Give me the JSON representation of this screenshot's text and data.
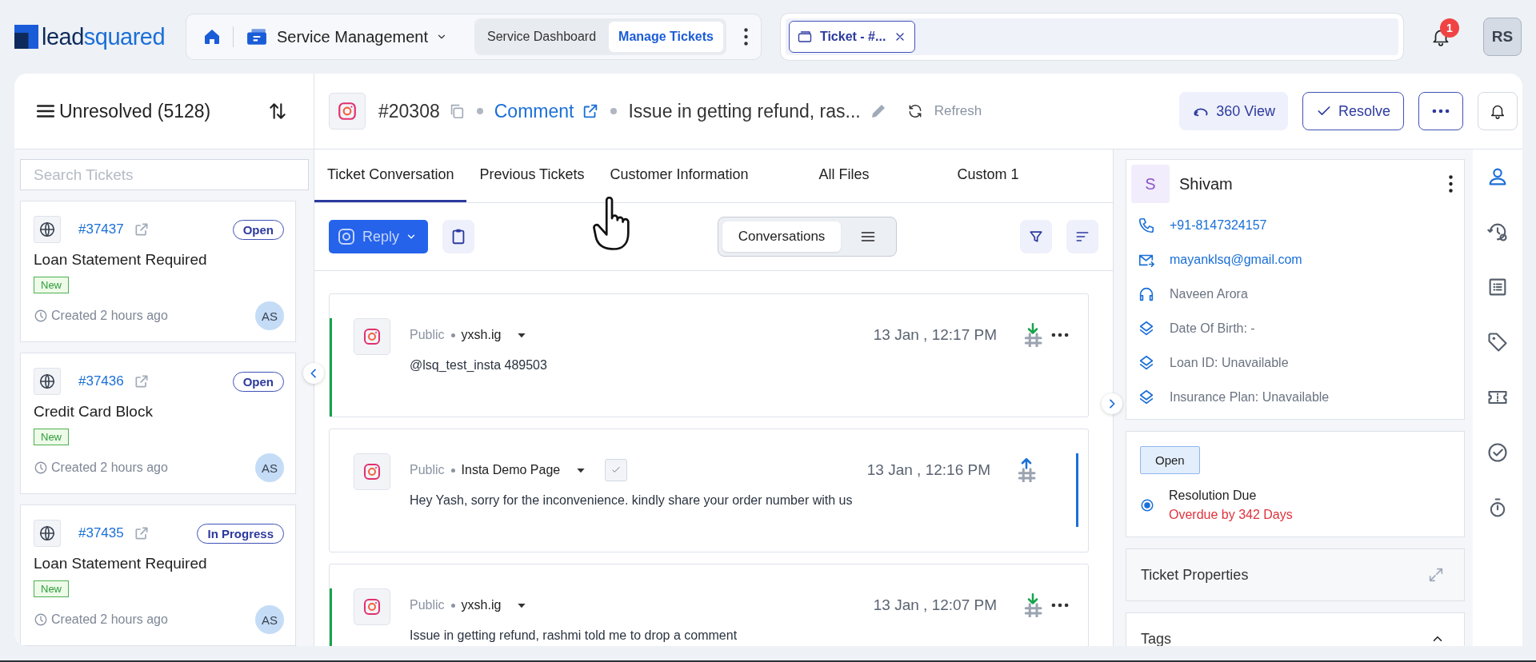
{
  "header": {
    "logo": {
      "dark_part": "lead",
      "accent_part": "squared"
    },
    "app_name": "Service Management",
    "nav_tabs": [
      {
        "label": "Service Dashboard",
        "selected": false
      },
      {
        "label": "Manage Tickets",
        "selected": true
      }
    ],
    "open_tabs": [
      {
        "label": "Ticket - #..."
      }
    ],
    "notification_count": "1",
    "user_initials": "RS"
  },
  "ticket_list": {
    "title": "Unresolved (5128)",
    "search": {
      "placeholder": "Search Tickets"
    },
    "tickets": [
      {
        "number": "#37437",
        "status": "Open",
        "subject": "Loan Statement Required",
        "tag": "New",
        "created": "Created 2 hours ago",
        "assignee": "AS"
      },
      {
        "number": "#37436",
        "status": "Open",
        "subject": "Credit Card Block",
        "tag": "New",
        "created": "Created 2 hours ago",
        "assignee": "AS"
      },
      {
        "number": "#37435",
        "status": "In Progress",
        "subject": "Loan Statement Required",
        "tag": "New",
        "created": "Created 2 hours ago",
        "assignee": "AS"
      }
    ]
  },
  "ticket": {
    "number": "#20308",
    "channel": "Comment",
    "subject": "Issue in getting refund, ras...",
    "refresh": "Refresh",
    "view_button": "360 View",
    "resolve_button": "Resolve"
  },
  "tabs": [
    {
      "label": "Ticket Conversation",
      "selected": true
    },
    {
      "label": "Previous Tickets",
      "selected": false
    },
    {
      "label": "Customer Information",
      "selected": false
    },
    {
      "label": "All Files",
      "selected": false
    },
    {
      "label": "Custom 1",
      "selected": false
    }
  ],
  "toolbar": {
    "reply": "Reply",
    "view_modes": [
      {
        "kind": "text",
        "label": "Conversations",
        "selected": true
      },
      {
        "kind": "list",
        "selected": false
      }
    ]
  },
  "messages": [
    {
      "kind": "incoming",
      "visibility": "Public",
      "author": "yxsh.ig",
      "time": "13 Jan , 12:17 PM",
      "text": "@lsq_test_insta 489503"
    },
    {
      "kind": "outgoing",
      "visibility": "Public",
      "author": "Insta Demo Page",
      "time": "13 Jan , 12:16 PM",
      "text": "Hey Yash, sorry for the inconvenience. kindly share your order number with us",
      "checked": true
    },
    {
      "kind": "incoming",
      "visibility": "Public",
      "author": "yxsh.ig",
      "time": "13 Jan , 12:07 PM",
      "text": "Issue in getting refund, rashmi told me to drop a comment"
    }
  ],
  "contact": {
    "initial": "S",
    "name": "Shivam",
    "fields": [
      {
        "kind": "phone",
        "text": "+91-8147324157"
      },
      {
        "kind": "email",
        "text": "mayanklsq@gmail.com"
      },
      {
        "kind": "agent",
        "text": "Naveen Arora"
      },
      {
        "kind": "attribute",
        "text": "Date Of Birth: -"
      },
      {
        "kind": "attribute",
        "text": "Loan ID: Unavailable"
      },
      {
        "kind": "attribute",
        "text": "Insurance Plan: Unavailable"
      }
    ]
  },
  "sla": {
    "status": "Open",
    "label": "Resolution Due",
    "value": "Overdue by 342 Days"
  },
  "sections": [
    {
      "title": "Ticket Properties",
      "kind": "expand"
    },
    {
      "title": "Tags",
      "kind": "collapse"
    }
  ],
  "side_rail": [
    {
      "kind": "person",
      "selected": true
    },
    {
      "kind": "history",
      "selected": false
    },
    {
      "kind": "list",
      "selected": false
    },
    {
      "kind": "tag",
      "selected": false
    },
    {
      "kind": "ticket",
      "selected": false
    },
    {
      "kind": "check",
      "selected": false
    },
    {
      "kind": "timer",
      "selected": false
    }
  ]
}
